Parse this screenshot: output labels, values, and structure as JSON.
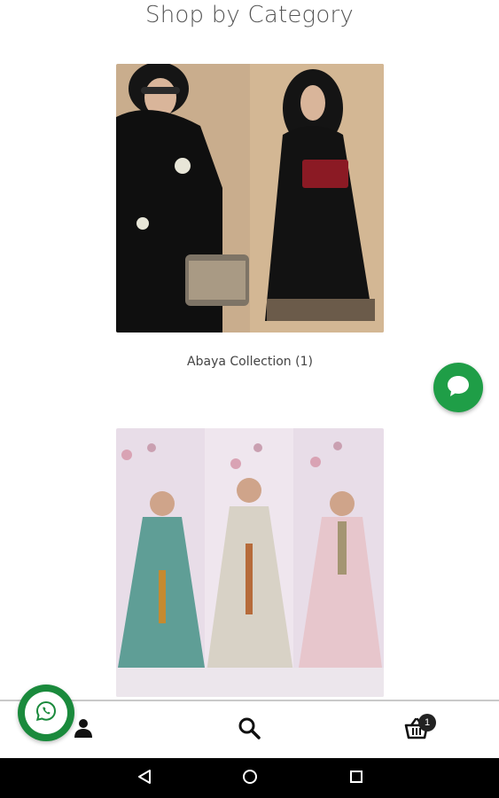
{
  "page": {
    "title": "Shop by Category"
  },
  "categories": [
    {
      "label": "Abaya Collection (1)",
      "image": "abaya-collection-photo"
    },
    {
      "label": "",
      "image": "kaftan-collection-photo"
    }
  ],
  "fabs": {
    "chat_icon": "chat-bubble-icon",
    "whatsapp_icon": "whatsapp-icon"
  },
  "bottom_nav": {
    "items": [
      {
        "icon": "user-icon"
      },
      {
        "icon": "search-icon"
      },
      {
        "icon": "basket-icon",
        "badge": "1"
      }
    ]
  },
  "system_nav": {
    "items": [
      "back-icon",
      "home-icon",
      "recents-icon"
    ]
  },
  "colors": {
    "accent_green": "#1f9e47",
    "dark_green": "#1a8a3c"
  }
}
